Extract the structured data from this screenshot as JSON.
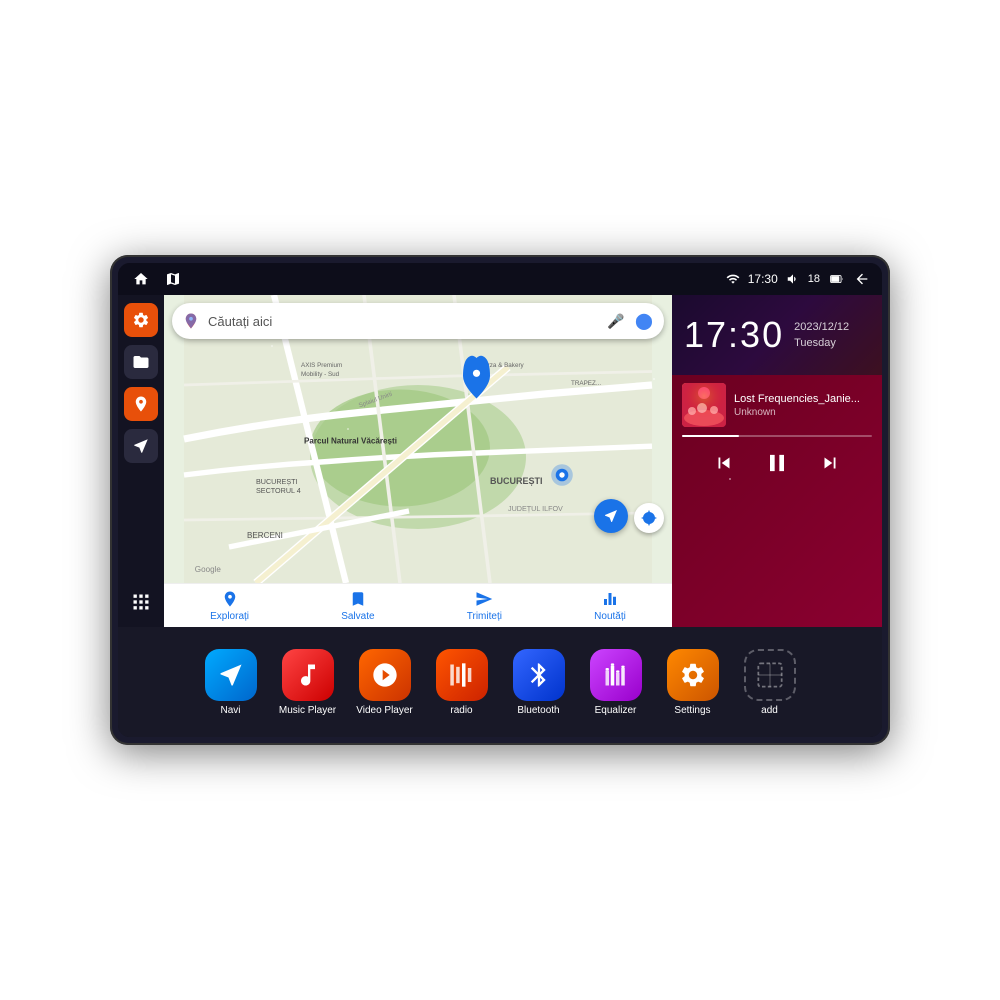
{
  "device": {
    "status_bar": {
      "left_icons": [
        "home",
        "maps"
      ],
      "time": "17:30",
      "wifi_signal": "▾",
      "volume_icon": "🔊",
      "battery_level": "18",
      "battery_icon": "🔋",
      "back_icon": "↩"
    },
    "clock": {
      "time": "17:30",
      "date": "2023/12/12",
      "day": "Tuesday"
    },
    "music": {
      "title": "Lost Frequencies_Janie...",
      "artist": "Unknown"
    },
    "map": {
      "search_placeholder": "Căutați aici",
      "labels": [
        "Parcul Natural Văcărești",
        "BUCUREȘTI",
        "JUDEȚUL ILFOV",
        "BERCENI",
        "BUCUREȘTI SECTORUL 4",
        "AXIS Premium Mobility - Sud",
        "Pizza & Bakery",
        "TRAPEZULUI"
      ],
      "tabs": [
        "Explorați",
        "Salvate",
        "Trimiteți",
        "Noutăți"
      ]
    },
    "sidebar": {
      "buttons": [
        "settings",
        "folder",
        "maps",
        "navigation"
      ]
    },
    "apps": [
      {
        "id": "navi",
        "label": "Navi",
        "icon": "navi"
      },
      {
        "id": "music-player",
        "label": "Music Player",
        "icon": "music"
      },
      {
        "id": "video-player",
        "label": "Video Player",
        "icon": "video"
      },
      {
        "id": "radio",
        "label": "radio",
        "icon": "radio"
      },
      {
        "id": "bluetooth",
        "label": "Bluetooth",
        "icon": "bluetooth"
      },
      {
        "id": "equalizer",
        "label": "Equalizer",
        "icon": "eq"
      },
      {
        "id": "settings",
        "label": "Settings",
        "icon": "settings"
      },
      {
        "id": "add",
        "label": "add",
        "icon": "add"
      }
    ]
  }
}
